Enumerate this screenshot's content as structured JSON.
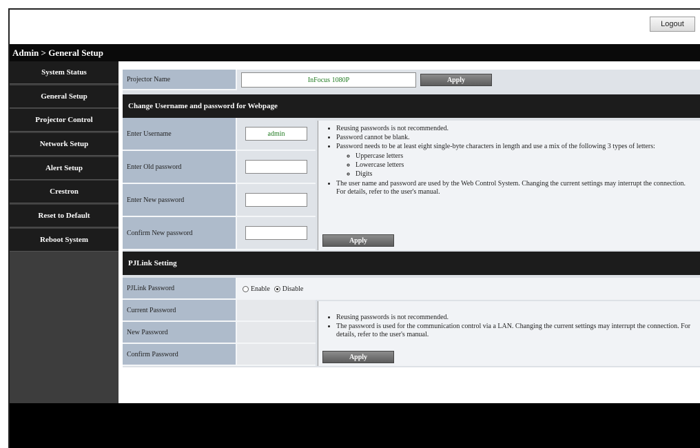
{
  "header": {
    "logout_label": "Logout",
    "breadcrumb": "Admin > General Setup"
  },
  "sidebar": {
    "items": [
      {
        "label": "System Status"
      },
      {
        "label": "General Setup"
      },
      {
        "label": "Projector Control"
      },
      {
        "label": "Network Setup"
      },
      {
        "label": "Alert Setup"
      },
      {
        "label": "Crestron"
      },
      {
        "label": "Reset to Default"
      },
      {
        "label": "Reboot System"
      }
    ]
  },
  "projector_name": {
    "label": "Projector Name",
    "value": "InFocus 1080P",
    "apply_label": "Apply"
  },
  "webpage_credentials": {
    "heading": "Change Username and password for Webpage",
    "username_label": "Enter Username",
    "username_value": "admin",
    "old_password_label": "Enter Old password",
    "new_password_label": "Enter New password",
    "confirm_password_label": "Confirm New password",
    "notes": {
      "n1": "Reusing passwords is not recommended.",
      "n2": "Password cannot be blank.",
      "n3": "Password needs to be at least eight single-byte characters in length and use a mix of the following 3 types of letters:",
      "types": {
        "t1": "Uppercase letters",
        "t2": "Lowercase letters",
        "t3": "Digits"
      },
      "n4": "The user name and password are used by the Web Control System. Changing the current settings may interrupt the connection. For details, refer to the user's manual."
    },
    "apply_label": "Apply"
  },
  "pjlink": {
    "heading": "PJLink Setting",
    "password_label": "PJLink Password",
    "enable_label": "Enable",
    "disable_label": "Disable",
    "selected": "Disable",
    "current_password_label": "Current Password",
    "new_password_label": "New Password",
    "confirm_password_label": "Confirm Password",
    "notes": {
      "n1": "Reusing passwords is not recommended.",
      "n2": "The password is used for the communication control via a LAN. Changing the current settings may interrupt the connection. For details, refer to the user's manual."
    },
    "apply_label": "Apply"
  }
}
